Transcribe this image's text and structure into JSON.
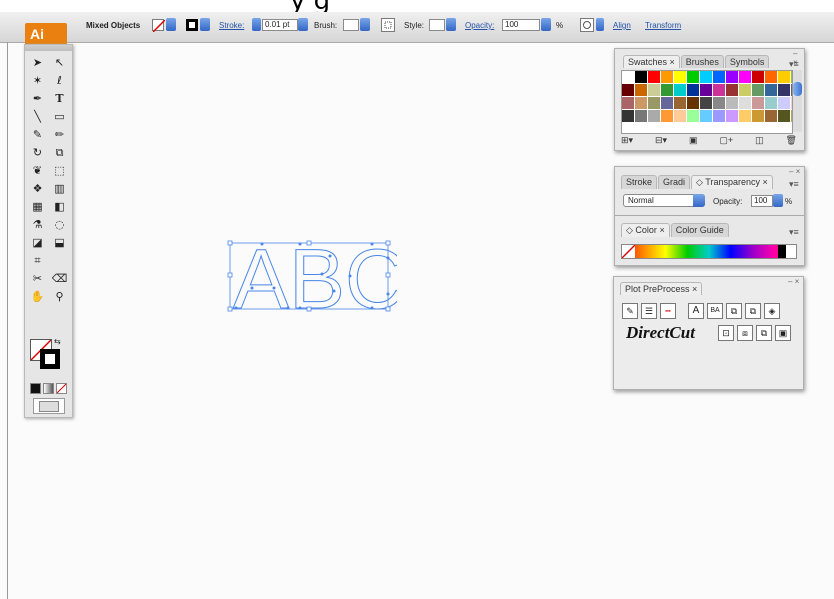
{
  "header_fragment": "y    g",
  "app": {
    "logo": "Ai"
  },
  "control_bar": {
    "selection_label": "Mixed Objects",
    "stroke_label": "Stroke:",
    "stroke_value": "0.01 pt",
    "brush_label": "Brush:",
    "style_label": "Style:",
    "opacity_label": "Opacity:",
    "opacity_value": "100",
    "percent": "%",
    "align_link": "Align",
    "transform_link": "Transform"
  },
  "swatches_panel": {
    "tabs": [
      "Swatches",
      "Brushes",
      "Symbols"
    ]
  },
  "stroke_panel": {
    "tabs": [
      "Stroke",
      "Gradi",
      "Transparency"
    ],
    "blend_mode": "Normal",
    "opacity_label": "Opacity:",
    "opacity_value": "100",
    "percent": "%"
  },
  "color_panel": {
    "tabs": [
      "Color",
      "Color Guide"
    ]
  },
  "plot_panel": {
    "tab": "Plot PreProcess",
    "directcut_label": "DirectCut",
    "ba_label": "BA"
  },
  "artboard": {
    "text": "ABC"
  },
  "colors": {
    "accent_blue": "#3a78d8",
    "ai_orange": "#e9800f",
    "selection_blue": "#4a86e8"
  }
}
